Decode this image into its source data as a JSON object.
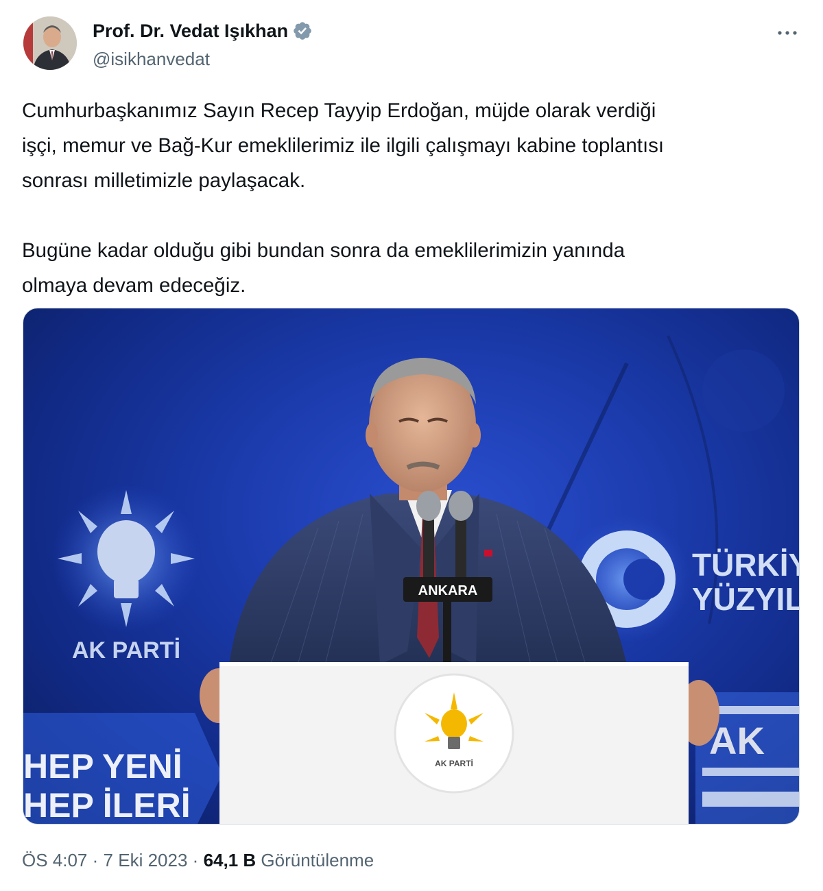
{
  "author": {
    "name": "Prof. Dr. Vedat Işıkhan",
    "handle": "@isikhanvedat",
    "verified_color": "#829aab"
  },
  "tweet": {
    "paragraphs": [
      "Cumhurbaşkanımız Sayın Recep Tayyip Erdoğan, müjde olarak verdiği",
      "işçi, memur ve Bağ-Kur emeklilerimiz ile ilgili çalışmayı kabine toplantısı",
      "sonrası milletimizle paylaşacak.",
      "",
      "Bugüne kadar olduğu gibi bundan sonra da emeklilerimizin yanında",
      "olmaya devam edeceğiz."
    ]
  },
  "media": {
    "lectern_logo_text": "AK PARTİ",
    "left_logo_text": "AK PARTİ",
    "mic_label": "ANKARA",
    "banner_left": [
      "HEP YENİ",
      "HEP İLERİ"
    ],
    "banner_right": [
      "TÜRKİYE",
      "YÜZYILI"
    ],
    "bottom_right_text": [
      "AK"
    ]
  },
  "meta": {
    "time": "ÖS 4:07",
    "separator": "·",
    "date": "7 Eki 2023",
    "views_count": "64,1 B",
    "views_label": "Görüntülenme"
  },
  "colors": {
    "text": "#0f1419",
    "secondary": "#536471",
    "stage_blue": "#1c3cae"
  },
  "icons": [
    "verified-badge-icon",
    "more-options-icon"
  ]
}
